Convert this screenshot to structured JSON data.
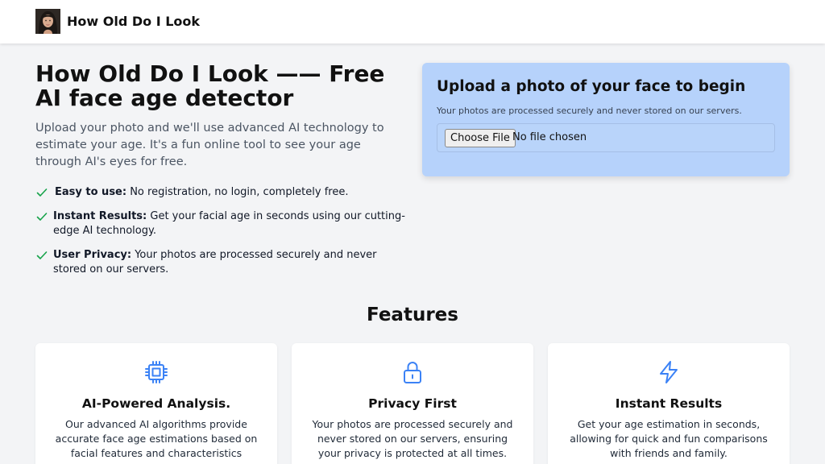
{
  "header": {
    "brand": "How Old Do I Look",
    "logo_icon": "face-photo-avatar"
  },
  "hero": {
    "title": "How Old Do I Look —— Free AI face age detector",
    "description": "Upload your photo and we'll use advanced AI technology to estimate your age. It's a fun online tool to see your age through AI's eyes for free.",
    "benefits": [
      {
        "label": "Easy to use:",
        "text": " No registration, no login, completely free."
      },
      {
        "label": "Instant Results:",
        "text": " Get your facial age in seconds using our cutting-edge AI technology."
      },
      {
        "label": "User Privacy:",
        "text": " Your photos are processed securely and never stored on our servers."
      }
    ],
    "check_color": "#16a34a"
  },
  "upload": {
    "title": "Upload a photo of your face to begin",
    "note": "Your photos are processed securely and never stored on our servers.",
    "button_label": "Choose File",
    "file_status": "No file chosen",
    "card_color": "#b6d2fb"
  },
  "features": {
    "heading": "Features",
    "icon_color": "#3b82f6",
    "items": [
      {
        "icon": "cpu-chip-icon",
        "title": "AI-Powered Analysis.",
        "description": "Our advanced AI algorithms provide accurate face age estimations based on facial features and characteristics"
      },
      {
        "icon": "lock-icon",
        "title": "Privacy First",
        "description": "Your photos are processed securely and never stored on our servers, ensuring your privacy is protected at all times."
      },
      {
        "icon": "lightning-bolt-icon",
        "title": "Instant Results",
        "description": "Get your age estimation in seconds, allowing for quick and fun comparisons with friends and family."
      }
    ]
  }
}
